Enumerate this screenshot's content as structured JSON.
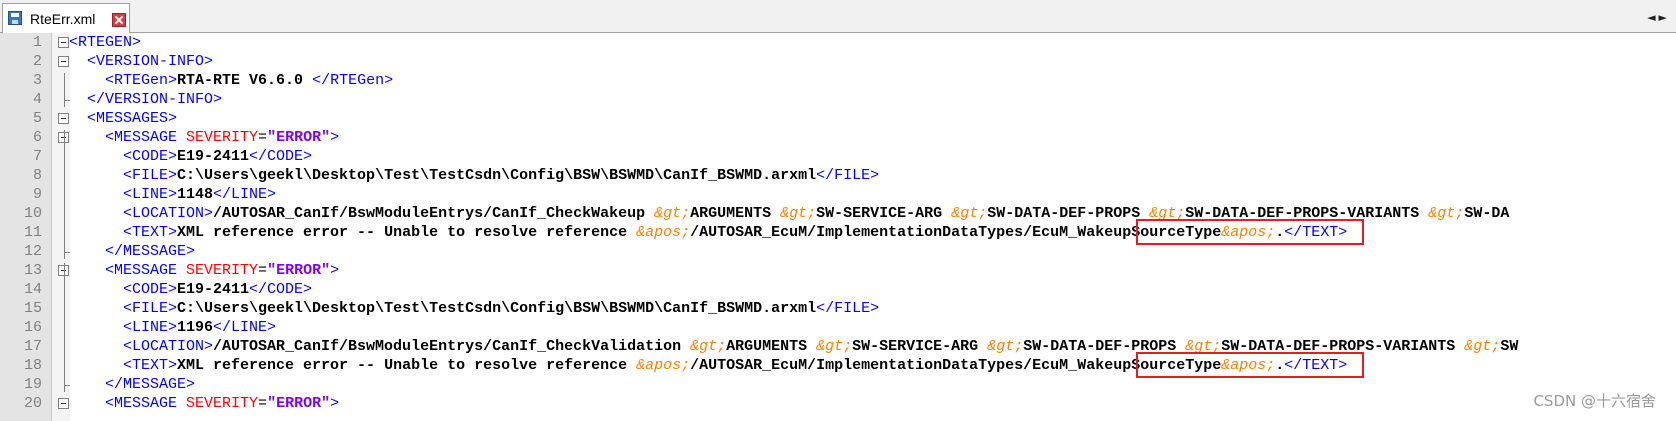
{
  "tab": {
    "title": "RteErr.xml",
    "icon": "save-disk-icon",
    "close_icon": "close-icon",
    "scroll_arrows": "◄►"
  },
  "colors": {
    "tag": "#0000ff",
    "text": "#000000",
    "attribute": "#ff0000",
    "attribute_value": "#8000ff",
    "entity": "#ff8000",
    "highlight_box": "#e41e1e"
  },
  "editor": {
    "lines": [
      {
        "n": "1",
        "segs": [
          [
            "tag",
            "<RTEGEN>"
          ]
        ]
      },
      {
        "n": "2",
        "segs": [
          [
            "tag",
            "  <VERSION-INFO>"
          ]
        ]
      },
      {
        "n": "3",
        "segs": [
          [
            "tag",
            "    <RTEGen>"
          ],
          [
            "txt",
            "RTA-RTE V6.6.0 "
          ],
          [
            "tag",
            "</RTEGen>"
          ]
        ]
      },
      {
        "n": "4",
        "segs": [
          [
            "tag",
            "  </VERSION-INFO>"
          ]
        ]
      },
      {
        "n": "5",
        "segs": [
          [
            "tag",
            "  <MESSAGES>"
          ]
        ]
      },
      {
        "n": "6",
        "segs": [
          [
            "tag",
            "    <MESSAGE "
          ],
          [
            "attr",
            "SEVERITY"
          ],
          [
            "eq",
            "="
          ],
          [
            "val",
            "\"ERROR\""
          ],
          [
            "tag",
            ">"
          ]
        ]
      },
      {
        "n": "7",
        "segs": [
          [
            "tag",
            "      <CODE>"
          ],
          [
            "txt",
            "E19-2411"
          ],
          [
            "tag",
            "</CODE>"
          ]
        ]
      },
      {
        "n": "8",
        "segs": [
          [
            "tag",
            "      <FILE>"
          ],
          [
            "txt",
            "C:\\Users\\geekl\\Desktop\\Test\\TestCsdn\\Config\\BSW\\BSWMD\\CanIf_BSWMD.arxml"
          ],
          [
            "tag",
            "</FILE>"
          ]
        ]
      },
      {
        "n": "9",
        "segs": [
          [
            "tag",
            "      <LINE>"
          ],
          [
            "txt",
            "1148"
          ],
          [
            "tag",
            "</LINE>"
          ]
        ]
      },
      {
        "n": "10",
        "segs": [
          [
            "tag",
            "      <LOCATION>"
          ],
          [
            "txt",
            "/AUTOSAR_CanIf/BswModuleEntrys/CanIf_CheckWakeup "
          ],
          [
            "ent",
            "&gt;"
          ],
          [
            "txt",
            "ARGUMENTS "
          ],
          [
            "ent",
            "&gt;"
          ],
          [
            "txt",
            "SW-SERVICE-ARG "
          ],
          [
            "ent",
            "&gt;"
          ],
          [
            "txt",
            "SW-DATA-DEF-PROPS "
          ],
          [
            "ent",
            "&gt;"
          ],
          [
            "txt",
            "SW-DATA-DEF-PROPS-VARIANTS "
          ],
          [
            "ent",
            "&gt;"
          ],
          [
            "txt",
            "SW-DA"
          ]
        ]
      },
      {
        "n": "11",
        "segs": [
          [
            "tag",
            "      <TEXT>"
          ],
          [
            "txt",
            "XML reference error -- Unable to resolve reference "
          ],
          [
            "ent",
            "&apos;"
          ],
          [
            "txt",
            "/AUTOSAR_EcuM/ImplementationDataTypes/EcuM_WakeupSourceType"
          ],
          [
            "ent",
            "&apos;"
          ],
          [
            "txt",
            "."
          ],
          [
            "tag",
            "</TEXT>"
          ]
        ]
      },
      {
        "n": "12",
        "segs": [
          [
            "tag",
            "    </MESSAGE>"
          ]
        ]
      },
      {
        "n": "13",
        "segs": [
          [
            "tag",
            "    <MESSAGE "
          ],
          [
            "attr",
            "SEVERITY"
          ],
          [
            "eq",
            "="
          ],
          [
            "val",
            "\"ERROR\""
          ],
          [
            "tag",
            ">"
          ]
        ]
      },
      {
        "n": "14",
        "segs": [
          [
            "tag",
            "      <CODE>"
          ],
          [
            "txt",
            "E19-2411"
          ],
          [
            "tag",
            "</CODE>"
          ]
        ]
      },
      {
        "n": "15",
        "segs": [
          [
            "tag",
            "      <FILE>"
          ],
          [
            "txt",
            "C:\\Users\\geekl\\Desktop\\Test\\TestCsdn\\Config\\BSW\\BSWMD\\CanIf_BSWMD.arxml"
          ],
          [
            "tag",
            "</FILE>"
          ]
        ]
      },
      {
        "n": "16",
        "segs": [
          [
            "tag",
            "      <LINE>"
          ],
          [
            "txt",
            "1196"
          ],
          [
            "tag",
            "</LINE>"
          ]
        ]
      },
      {
        "n": "17",
        "segs": [
          [
            "tag",
            "      <LOCATION>"
          ],
          [
            "txt",
            "/AUTOSAR_CanIf/BswModuleEntrys/CanIf_CheckValidation "
          ],
          [
            "ent",
            "&gt;"
          ],
          [
            "txt",
            "ARGUMENTS "
          ],
          [
            "ent",
            "&gt;"
          ],
          [
            "txt",
            "SW-SERVICE-ARG "
          ],
          [
            "ent",
            "&gt;"
          ],
          [
            "txt",
            "SW-DATA-DEF-PROPS "
          ],
          [
            "ent",
            "&gt;"
          ],
          [
            "txt",
            "SW-DATA-DEF-PROPS-VARIANTS "
          ],
          [
            "ent",
            "&gt;"
          ],
          [
            "txt",
            "SW"
          ]
        ]
      },
      {
        "n": "18",
        "segs": [
          [
            "tag",
            "      <TEXT>"
          ],
          [
            "txt",
            "XML reference error -- Unable to resolve reference "
          ],
          [
            "ent",
            "&apos;"
          ],
          [
            "txt",
            "/AUTOSAR_EcuM/ImplementationDataTypes/EcuM_WakeupSourceType"
          ],
          [
            "ent",
            "&apos;"
          ],
          [
            "txt",
            "."
          ],
          [
            "tag",
            "</TEXT>"
          ]
        ]
      },
      {
        "n": "19",
        "segs": [
          [
            "tag",
            "    </MESSAGE>"
          ]
        ]
      },
      {
        "n": "20",
        "segs": [
          [
            "tag",
            "    <MESSAGE "
          ],
          [
            "attr",
            "SEVERITY"
          ],
          [
            "eq",
            "="
          ],
          [
            "val",
            "\"ERROR\""
          ],
          [
            "tag",
            ">"
          ]
        ]
      }
    ]
  },
  "watermark": "CSDN @十六宿舍"
}
